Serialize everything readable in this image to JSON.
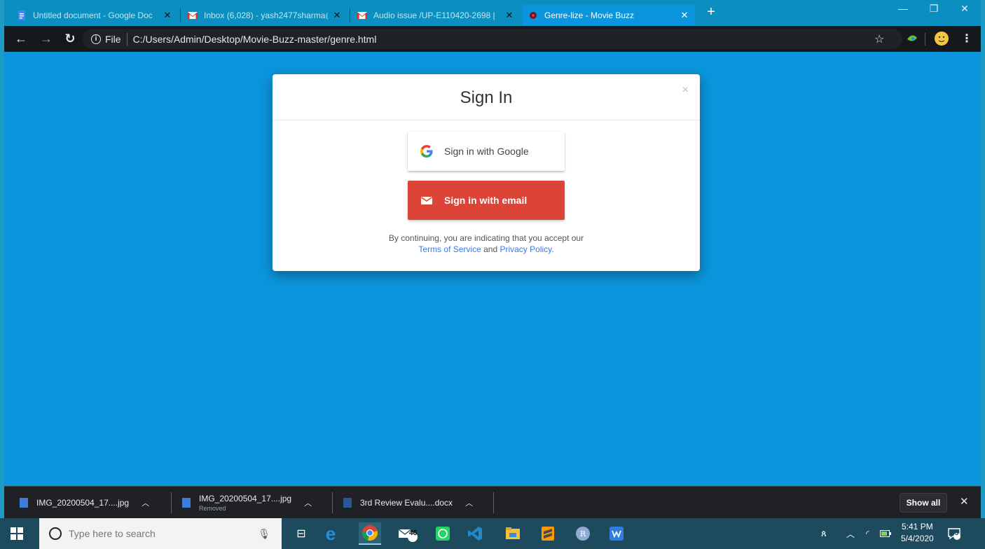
{
  "browser": {
    "tabs": [
      {
        "title": "Untitled document - Google Doc",
        "icon": "docs-icon"
      },
      {
        "title": "Inbox (6,028) - yash2477sharma@",
        "icon": "gmail-icon"
      },
      {
        "title": "Audio issue /UP-E110420-2698 | ",
        "icon": "gmail-icon"
      },
      {
        "title": "Genre-lize - Movie Buzz",
        "icon": "site-icon"
      }
    ],
    "new_tab": "+",
    "address": {
      "info": "i",
      "scheme": "File",
      "url": "C:/Users/Admin/Desktop/Movie-Buzz-master/genre.html"
    }
  },
  "modal": {
    "title": "Sign In",
    "close": "×",
    "google_label": "Sign in with Google",
    "email_label": "Sign in with email",
    "tos_prefix": "By continuing, you are indicating that you accept our",
    "tos_link": "Terms of Service",
    "tos_and": "and",
    "privacy_link": "Privacy Policy",
    "tos_suffix": "."
  },
  "downloads": {
    "items": [
      {
        "name": "IMG_20200504_17....jpg",
        "sub": ""
      },
      {
        "name": "IMG_20200504_17....jpg",
        "sub": "Removed"
      },
      {
        "name": "3rd Review Evalu....docx",
        "sub": ""
      }
    ],
    "show_all": "Show all"
  },
  "taskbar": {
    "search_placeholder": "Type here to search",
    "mail_badge": "46",
    "time": "5:41 PM",
    "date": "5/4/2020",
    "notification_count": "3"
  },
  "colors": {
    "page_bg": "#0b95dc",
    "email_button": "#db4437",
    "link": "#3b78e7"
  }
}
